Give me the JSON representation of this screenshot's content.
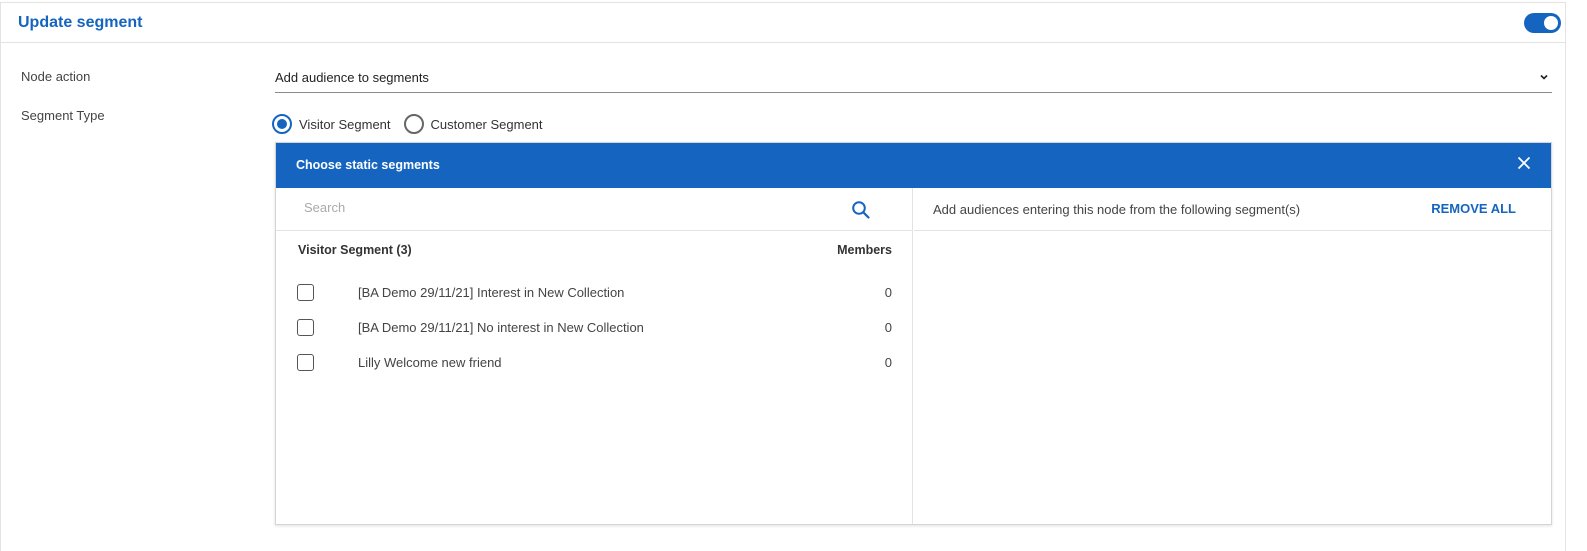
{
  "header": {
    "title": "Update segment",
    "toggle_on": true
  },
  "form": {
    "node_action_label": "Node action",
    "node_action_value": "Add audience to segments",
    "segment_type_label": "Segment Type",
    "segment_types": [
      {
        "label": "Visitor Segment",
        "checked": true
      },
      {
        "label": "Customer Segment",
        "checked": false
      }
    ]
  },
  "panel": {
    "title": "Choose static segments",
    "search_placeholder": "Search",
    "list_heading": "Visitor Segment (3)",
    "members_heading": "Members",
    "segments": [
      {
        "name": "[BA Demo 29/11/21] Interest in New Collection",
        "members": "0",
        "checked": false
      },
      {
        "name": "[BA Demo 29/11/21] No interest in New Collection",
        "members": "0",
        "checked": false
      },
      {
        "name": "Lilly Welcome new friend",
        "members": "0",
        "checked": false
      }
    ],
    "right_description": "Add audiences entering this node from the following segment(s)",
    "remove_all": "REMOVE ALL"
  },
  "colors": {
    "accent": "#1565c0",
    "border": "#e3e3e3"
  },
  "icons": {
    "toggle": "toggle-icon",
    "chevron": "chevron-down-icon",
    "close": "close-icon",
    "search": "search-icon"
  }
}
